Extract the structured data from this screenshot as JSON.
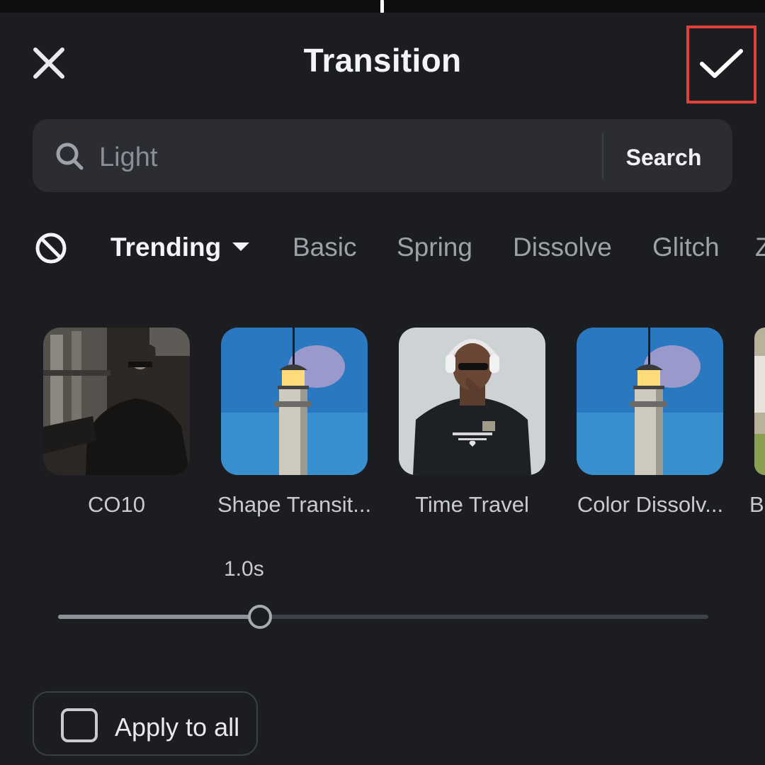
{
  "header": {
    "title": "Transition",
    "close_icon": "close-icon",
    "confirm_icon": "checkmark-icon",
    "confirm_highlight_color": "#e0403a"
  },
  "search": {
    "placeholder": "Light",
    "value": "",
    "button_label": "Search",
    "icon": "search-icon"
  },
  "categories": {
    "none_icon": "no-transition-icon",
    "items": [
      {
        "label": "Trending",
        "active": true,
        "has_dropdown": true
      },
      {
        "label": "Basic",
        "active": false
      },
      {
        "label": "Spring",
        "active": false
      },
      {
        "label": "Dissolve",
        "active": false
      },
      {
        "label": "Glitch",
        "active": false
      },
      {
        "label": "Z",
        "active": false
      }
    ]
  },
  "transitions": [
    {
      "label": "CO10",
      "thumbnail": "woman-portrait-photo"
    },
    {
      "label": "Shape Transit...",
      "thumbnail": "lighthouse-photo"
    },
    {
      "label": "Time Travel",
      "thumbnail": "man-headphones-photo"
    },
    {
      "label": "Color Dissolv...",
      "thumbnail": "lighthouse-photo"
    },
    {
      "label": "B",
      "thumbnail": "partial-photo"
    }
  ],
  "duration": {
    "label": "1.0s",
    "slider_fraction": 0.31
  },
  "apply_all": {
    "label": "Apply to all",
    "checked": false
  }
}
